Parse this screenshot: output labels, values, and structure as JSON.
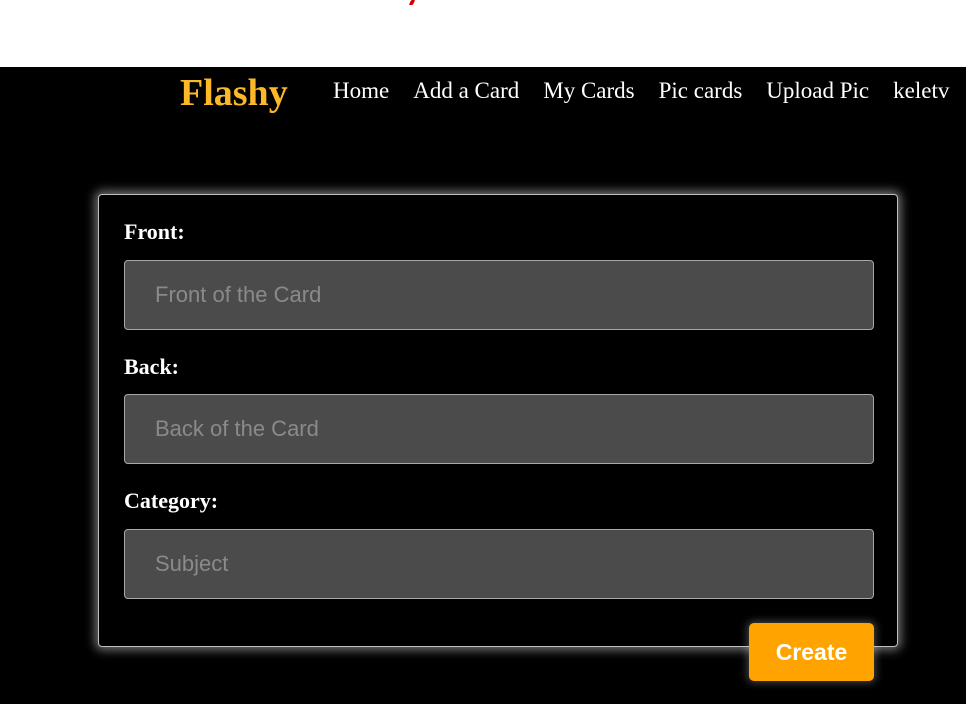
{
  "colors": {
    "brand": "#fbb829",
    "background": "#000000",
    "input_background": "#4b4b4b",
    "button": "#ffa300"
  },
  "navbar": {
    "brand": "Flashy",
    "links": [
      "Home",
      "Add a Card",
      "My Cards",
      "Pic cards",
      "Upload Pic",
      "keletv"
    ]
  },
  "form": {
    "front": {
      "label": "Front:",
      "placeholder": "Front of the Card",
      "value": ""
    },
    "back": {
      "label": "Back:",
      "placeholder": "Back of the Card",
      "value": ""
    },
    "category": {
      "label": "Category:",
      "placeholder": "Subject",
      "value": ""
    },
    "submit_label": "Create"
  }
}
